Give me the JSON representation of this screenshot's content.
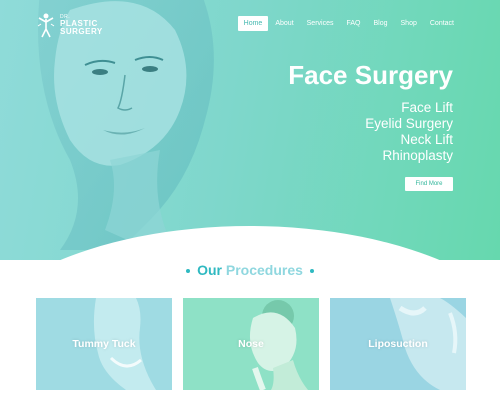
{
  "logo": {
    "line1": "DR.",
    "line2": "PLASTIC",
    "line3": "SURGERY"
  },
  "nav": {
    "items": [
      {
        "label": "Home",
        "active": true
      },
      {
        "label": "About"
      },
      {
        "label": "Services"
      },
      {
        "label": "FAQ"
      },
      {
        "label": "Blog"
      },
      {
        "label": "Shop"
      },
      {
        "label": "Contact"
      }
    ]
  },
  "hero": {
    "title": "Face Surgery",
    "list": [
      "Face Lift",
      "Eyelid Surgery",
      "Neck Lift",
      "Rhinoplasty"
    ],
    "button": "Find More"
  },
  "procedures": {
    "heading_bold": "Our",
    "heading_rest": "Procedures",
    "cards": [
      {
        "label": "Tummy Tuck",
        "color": "#9fdbe3"
      },
      {
        "label": "Nose",
        "color": "#8ee1c6"
      },
      {
        "label": "Liposuction",
        "color": "#9ad5e3"
      }
    ]
  },
  "colors": {
    "accent": "#2fb9c1",
    "hero_start": "#8fdbd9",
    "hero_end": "#66d8ae"
  }
}
